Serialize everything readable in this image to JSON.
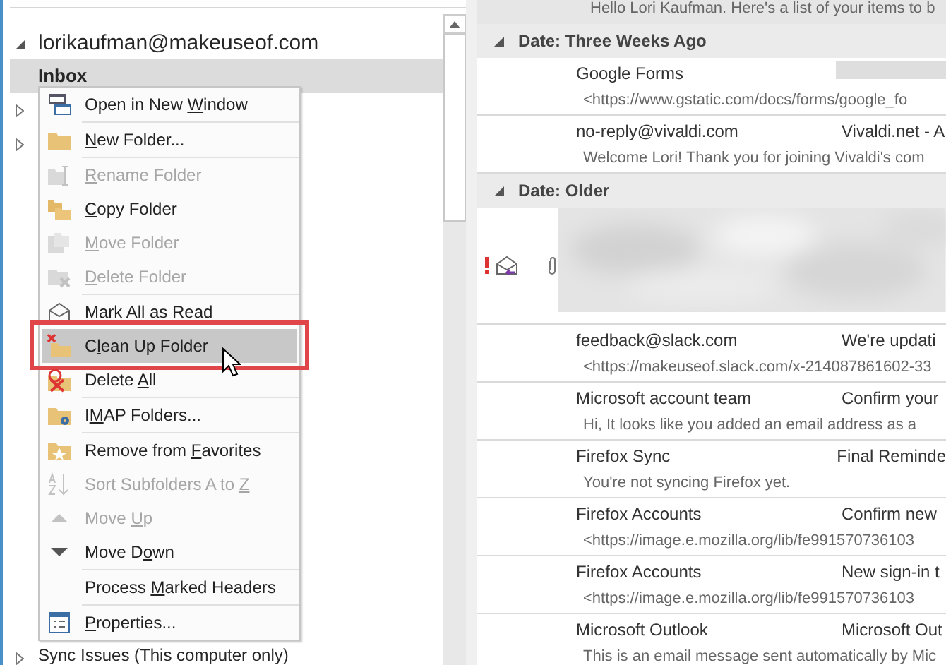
{
  "folder_pane": {
    "account": {
      "name": "lorikaufman@makeuseof.com",
      "expanded": true
    },
    "folders": [
      {
        "name": "Inbox",
        "selected": true
      },
      {
        "selected": false,
        "expandable": true
      },
      {
        "selected": false,
        "expandable": true
      },
      {
        "name": "Sync Issues (This computer only)",
        "selected": false,
        "expandable": true
      }
    ]
  },
  "context_menu": {
    "groups": [
      [
        {
          "label": {
            "pre": "Open in New ",
            "key": "W",
            "post": "indow"
          },
          "disabled": false,
          "selected": false,
          "annotated": false
        }
      ],
      [
        {
          "label": {
            "key": "N",
            "post": "ew Folder..."
          },
          "disabled": false,
          "selected": false,
          "annotated": false
        }
      ],
      [
        {
          "label": {
            "key": "R",
            "post": "ename Folder"
          },
          "disabled": true,
          "selected": false,
          "annotated": false
        },
        {
          "label": {
            "key": "C",
            "post": "opy Folder"
          },
          "disabled": false,
          "selected": false,
          "annotated": false
        },
        {
          "label": {
            "key": "M",
            "post": "ove Folder"
          },
          "disabled": true,
          "selected": false,
          "annotated": false
        },
        {
          "label": {
            "key": "D",
            "post": "elete Folder"
          },
          "disabled": true,
          "selected": false,
          "annotated": false
        }
      ],
      [
        {
          "label": {
            "pre": "Mark All as Read"
          },
          "disabled": false,
          "selected": false,
          "annotated": false
        },
        {
          "label": {
            "pre": "C",
            "key": "l",
            "post": "ean Up Folder"
          },
          "disabled": false,
          "selected": true,
          "annotated": true
        },
        {
          "label": {
            "pre": "Delete ",
            "key": "A",
            "post": "ll"
          },
          "disabled": false,
          "selected": false,
          "annotated": false
        }
      ],
      [
        {
          "label": {
            "pre": "I",
            "key": "M",
            "post": "AP Folders..."
          },
          "disabled": false,
          "selected": false,
          "annotated": false
        }
      ],
      [
        {
          "label": {
            "pre": "Remove from ",
            "key": "F",
            "post": "avorites"
          },
          "disabled": false,
          "selected": false,
          "annotated": false
        },
        {
          "label": {
            "pre": "Sort Subfolders A to ",
            "key": "Z"
          },
          "disabled": true,
          "selected": false,
          "annotated": false
        },
        {
          "label": {
            "pre": "Move ",
            "key": "U",
            "post": "p"
          },
          "disabled": true,
          "selected": false,
          "annotated": false
        },
        {
          "label": {
            "pre": "Move D",
            "key": "o",
            "post": "wn"
          },
          "disabled": false,
          "selected": false,
          "annotated": false
        }
      ],
      [
        {
          "label": {
            "pre": "Process ",
            "key": "M",
            "post": "arked Headers"
          },
          "disabled": false,
          "selected": false,
          "annotated": false
        }
      ],
      [
        {
          "label": {
            "key": "P",
            "post": "roperties..."
          },
          "disabled": false,
          "selected": false,
          "annotated": false
        }
      ]
    ]
  },
  "message_list": {
    "top_preview": "Hello Lori Kaufman. Here's a list of your items to b",
    "groups": [
      {
        "header": "Date: Three Weeks Ago",
        "expanded": true,
        "messages": [
          {
            "kind": "mail",
            "sender": "Google Forms",
            "subject_hidden": true,
            "preview": "<https://www.gstatic.com/docs/forms/google_fo"
          },
          {
            "kind": "mail",
            "sender": "no-reply@vivaldi.com",
            "subject": "Vivaldi.net - A",
            "preview": "Welcome Lori!  Thank you for joining Vivaldi's com"
          }
        ]
      },
      {
        "header": "Date: Older",
        "expanded": true,
        "messages": [
          {
            "kind": "blurred",
            "important": true,
            "replied": true,
            "attachment": true
          },
          {
            "kind": "mail",
            "sender": "feedback@slack.com",
            "subject": "We're updati",
            "preview": "<https://makeuseof.slack.com/x-214087861602-33"
          },
          {
            "kind": "mail",
            "sender": "Microsoft account team",
            "subject": "Confirm your",
            "preview": "Hi,  It looks like you added an email address as a"
          },
          {
            "kind": "mail",
            "sender": "Firefox Sync",
            "subject": "Final Reminde",
            "preview": "You're not syncing Firefox yet."
          },
          {
            "kind": "mail",
            "sender": "Firefox Accounts",
            "subject": "Confirm new",
            "preview": "<https://image.e.mozilla.org/lib/fe991570736103"
          },
          {
            "kind": "mail",
            "sender": "Firefox Accounts",
            "subject": "New sign-in t",
            "preview": "<https://image.e.mozilla.org/lib/fe991570736103"
          },
          {
            "kind": "mail",
            "sender": "Microsoft Outlook",
            "subject": "Microsoft Out",
            "preview": "This is an email message sent automatically by Mic"
          }
        ]
      }
    ]
  }
}
